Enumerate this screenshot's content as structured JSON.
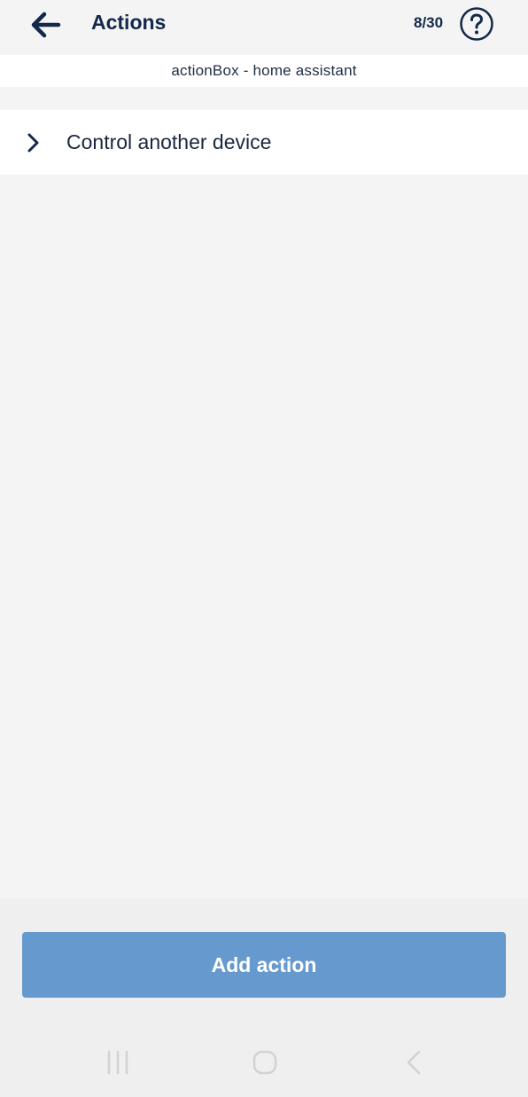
{
  "header": {
    "title": "Actions",
    "counter": "8/30",
    "back_icon": "arrow-left-icon",
    "help_icon": "question-circle-icon"
  },
  "device": {
    "name": "actionBox - home assistant"
  },
  "actions": [
    {
      "label": "Control another device",
      "icon": "chevron-right-icon"
    }
  ],
  "footer": {
    "add_label": "Add action"
  },
  "navbar": {
    "recents_icon": "recent-apps-icon",
    "home_icon": "home-icon",
    "back_icon": "back-icon"
  },
  "colors": {
    "primary_text": "#13284a",
    "button_bg": "#6699cd",
    "background": "#f4f4f4"
  }
}
